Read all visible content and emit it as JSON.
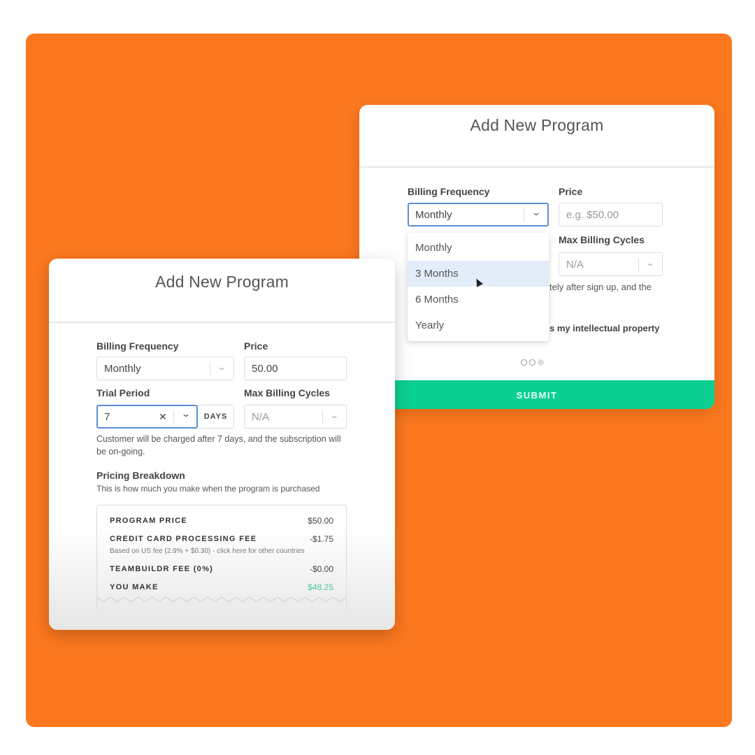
{
  "colors": {
    "background_orange": "#fb781f",
    "submit_green": "#0ccf92",
    "focus_blue": "#5b8fd6",
    "hover_option": "#e3edfa",
    "earnings_green": "#4cc79a"
  },
  "back_card": {
    "title": "Add New Program",
    "billing_frequency_label": "Billing Frequency",
    "billing_frequency_value": "Monthly",
    "price_label": "Price",
    "price_placeholder": "e.g. $50.00",
    "max_billing_label": "Max Billing Cycles",
    "max_billing_value": "N/A",
    "partial_help_text": "tely after sign up, and the",
    "partial_checkbox_text": "s my intellectual property",
    "dropdown_options": [
      {
        "label": "Monthly"
      },
      {
        "label": "3 Months"
      },
      {
        "label": "6 Months"
      },
      {
        "label": "Yearly"
      }
    ],
    "hovered_option": "3 Months",
    "pagination": {
      "total": 3,
      "current": 3
    },
    "submit_label": "SUBMIT"
  },
  "front_card": {
    "title": "Add New Program",
    "billing_frequency_label": "Billing Frequency",
    "billing_frequency_value": "Monthly",
    "price_label": "Price",
    "price_value": "50.00",
    "trial_period_label": "Trial Period",
    "trial_period_value": "7",
    "trial_unit": "DAYS",
    "max_billing_label": "Max Billing Cycles",
    "max_billing_value": "N/A",
    "help_text": "Customer will be charged after 7 days, and the subscription will be on-going.",
    "pricing_title": "Pricing Breakdown",
    "pricing_subtitle": "This is how much you make when the program is purchased",
    "breakdown": [
      {
        "label": "PROGRAM PRICE",
        "amount": "$50.00"
      },
      {
        "label": "CREDIT CARD PROCESSING FEE",
        "amount": "-$1.75",
        "note": "Based on US fee (2.9% + $0.30) - click here for other countries"
      },
      {
        "label": "TEAMBUILDR FEE (0%)",
        "amount": "-$0.00"
      },
      {
        "label": "YOU MAKE",
        "amount": "$48.25"
      }
    ]
  }
}
